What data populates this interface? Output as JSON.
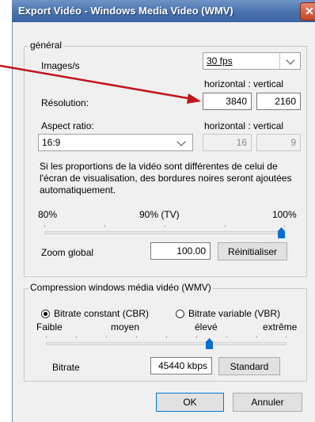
{
  "dialog": {
    "title": "Export Vidéo - Windows Media Video (WMV)"
  },
  "general": {
    "legend": "général",
    "images_label": "Images/s",
    "fps_value": "30 fps",
    "hv_label": "horizontal : vertical",
    "resolution_label": "Résolution:",
    "res_h": "3840",
    "res_v": "2160",
    "aspect_label": "Aspect ratio:",
    "aspect_value": "16:9",
    "aspect_h": "16",
    "aspect_v": "9",
    "info_text": "Si les proportions de la vidéo sont différentes de celui de l'écran de visualisation, des bordures noires seront ajoutées automatiquement.",
    "zoom_min": "80%",
    "zoom_mid": "90% (TV)",
    "zoom_max": "100%",
    "zoom_level": 1.0,
    "zoom_label": "Zoom global",
    "zoom_value": "100.00",
    "reset_label": "Réinitialiser"
  },
  "compression": {
    "legend": "Compression windows média vidéo (WMV)",
    "cbr_label": "Bitrate constant (CBR)",
    "vbr_label": "Bitrate variable (VBR)",
    "selected": "CBR",
    "levels": [
      "Faible",
      "moyen",
      "élevé",
      "extrême"
    ],
    "bitrate_level": 0.68,
    "bitrate_label": "Bitrate",
    "bitrate_value": "45440 kbps",
    "standard_label": "Standard"
  },
  "footer": {
    "ok_label": "OK",
    "cancel_label": "Annuler"
  },
  "colors": {
    "annotation_arrow": "#c0141c",
    "title_bar": "#4a72ad",
    "slider_thumb": "#0a6ed1"
  }
}
